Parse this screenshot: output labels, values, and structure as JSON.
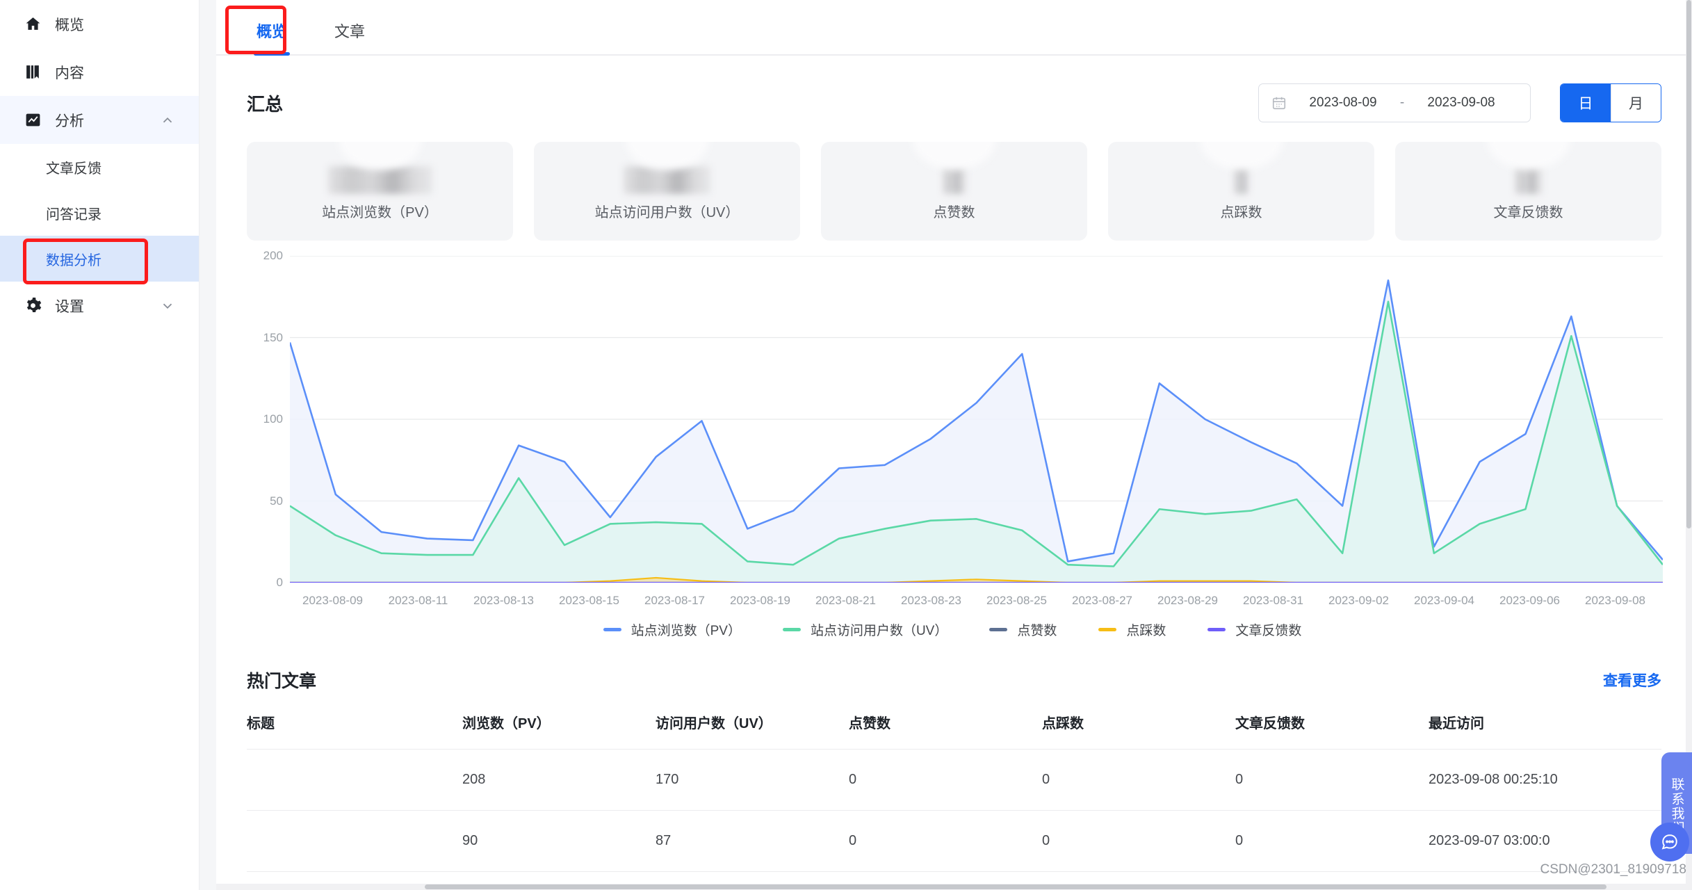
{
  "sidebar": {
    "items": [
      {
        "label": "概览",
        "icon": "home-icon",
        "type": "item"
      },
      {
        "label": "内容",
        "icon": "book-icon",
        "type": "item"
      },
      {
        "label": "分析",
        "icon": "chart-icon",
        "type": "group",
        "expanded": true,
        "chevron": "chevron-up-icon"
      },
      {
        "label": "文章反馈",
        "type": "sub"
      },
      {
        "label": "问答记录",
        "type": "sub"
      },
      {
        "label": "数据分析",
        "type": "sub",
        "active": true
      },
      {
        "label": "设置",
        "icon": "gear-icon",
        "type": "group",
        "expanded": false,
        "chevron": "chevron-down-icon"
      }
    ]
  },
  "tabs": [
    {
      "label": "概览",
      "active": true
    },
    {
      "label": "文章",
      "active": false
    }
  ],
  "summary": {
    "title": "汇总",
    "date_range": {
      "start": "2023-08-09",
      "separator": "-",
      "end": "2023-09-08",
      "icon": "calendar-icon"
    },
    "granularity": {
      "day": "日",
      "month": "月",
      "selected": "日"
    },
    "cards": [
      {
        "caption": "站点浏览数（PV）",
        "value": "",
        "redacted": true,
        "blur_width": 150
      },
      {
        "caption": "站点访问用户数（UV）",
        "value": "",
        "redacted": true,
        "blur_width": 125
      },
      {
        "caption": "点赞数",
        "value": "",
        "redacted": true,
        "blur_width": 34
      },
      {
        "caption": "点踩数",
        "value": "",
        "redacted": true,
        "blur_width": 22
      },
      {
        "caption": "文章反馈数",
        "value": "",
        "redacted": true,
        "blur_width": 40
      }
    ]
  },
  "chart_data": {
    "type": "area",
    "title": "",
    "xlabel": "",
    "ylabel": "",
    "ylim": [
      0,
      200
    ],
    "yticks": [
      0,
      50,
      100,
      150,
      200
    ],
    "grid": true,
    "legend_position": "bottom",
    "x": [
      "2023-08-09",
      "2023-08-10",
      "2023-08-11",
      "2023-08-12",
      "2023-08-13",
      "2023-08-14",
      "2023-08-15",
      "2023-08-16",
      "2023-08-17",
      "2023-08-18",
      "2023-08-19",
      "2023-08-20",
      "2023-08-21",
      "2023-08-22",
      "2023-08-23",
      "2023-08-24",
      "2023-08-25",
      "2023-08-26",
      "2023-08-27",
      "2023-08-28",
      "2023-08-29",
      "2023-08-30",
      "2023-08-31",
      "2023-09-01",
      "2023-09-02",
      "2023-09-03",
      "2023-09-04",
      "2023-09-05",
      "2023-09-06",
      "2023-09-07",
      "2023-09-08"
    ],
    "xtick_labels": [
      "2023-08-09",
      "2023-08-11",
      "2023-08-13",
      "2023-08-15",
      "2023-08-17",
      "2023-08-19",
      "2023-08-21",
      "2023-08-23",
      "2023-08-25",
      "2023-08-27",
      "2023-08-29",
      "2023-08-31",
      "2023-09-02",
      "2023-09-04",
      "2023-09-06",
      "2023-09-08"
    ],
    "series": [
      {
        "name": "站点浏览数（PV）",
        "color": "#5B8FF9",
        "fill": "#eef2fd",
        "values": [
          147,
          54,
          31,
          27,
          26,
          84,
          74,
          40,
          77,
          99,
          33,
          44,
          70,
          72,
          88,
          110,
          140,
          13,
          18,
          122,
          100,
          86,
          73,
          47,
          185,
          22,
          74,
          91,
          163,
          47,
          14
        ]
      },
      {
        "name": "站点访问用户数（UV）",
        "color": "#5AD8A6",
        "fill": "#e0f4f1",
        "values": [
          47,
          29,
          18,
          17,
          17,
          64,
          23,
          36,
          37,
          36,
          13,
          11,
          27,
          33,
          38,
          39,
          32,
          11,
          10,
          45,
          42,
          44,
          51,
          18,
          172,
          18,
          36,
          45,
          151,
          47,
          11
        ]
      },
      {
        "name": "点赞数",
        "color": "#5D7092",
        "fill": "transparent",
        "values": [
          0,
          0,
          0,
          0,
          0,
          0,
          0,
          0,
          0,
          0,
          0,
          0,
          0,
          0,
          0,
          0,
          0,
          0,
          0,
          0,
          0,
          0,
          0,
          0,
          0,
          0,
          0,
          0,
          0,
          0,
          0
        ]
      },
      {
        "name": "点踩数",
        "color": "#F6BD16",
        "fill": "#f3e2a8",
        "values": [
          0,
          0,
          0,
          0,
          0,
          0,
          0,
          1,
          3,
          1,
          0,
          0,
          0,
          0,
          1,
          2,
          1,
          0,
          0,
          1,
          1,
          1,
          0,
          0,
          0,
          0,
          0,
          0,
          0,
          0,
          0
        ]
      },
      {
        "name": "文章反馈数",
        "color": "#6F5EF9",
        "fill": "transparent",
        "values": [
          0,
          0,
          0,
          0,
          0,
          0,
          0,
          0,
          0,
          0,
          0,
          0,
          0,
          0,
          0,
          0,
          0,
          0,
          0,
          0,
          0,
          0,
          0,
          0,
          0,
          0,
          0,
          0,
          0,
          0,
          0
        ]
      }
    ]
  },
  "hot_articles": {
    "title": "热门文章",
    "more_label": "查看更多",
    "columns": [
      "标题",
      "浏览数（PV）",
      "访问用户数（UV）",
      "点赞数",
      "点踩数",
      "文章反馈数",
      "最近访问"
    ],
    "rows": [
      {
        "title": "",
        "title_redacted": true,
        "pv": "208",
        "uv": "170",
        "likes": "0",
        "dislikes": "0",
        "feedback": "0",
        "last_visit": "2023-09-08 00:25:10"
      },
      {
        "title": "",
        "title_redacted": true,
        "pv": "90",
        "uv": "87",
        "likes": "0",
        "dislikes": "0",
        "feedback": "0",
        "last_visit": "2023-09-07 03:00:0"
      }
    ]
  },
  "contact_widget": {
    "label": "联系我们",
    "icon": "chat-icon"
  },
  "watermark": "CSDN@2301_81909718",
  "colors": {
    "primary": "#1668f0",
    "active_bg": "#dbe7fb",
    "highlight": "#fb1c1c"
  }
}
